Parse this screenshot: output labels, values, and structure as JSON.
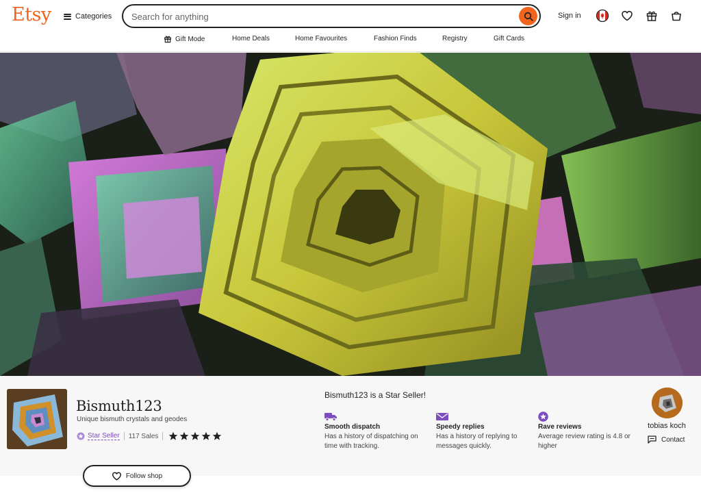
{
  "header": {
    "logo": "Etsy",
    "categories_label": "Categories",
    "search_placeholder": "Search for anything",
    "signin_label": "Sign in"
  },
  "subnav": {
    "items": [
      "Gift Mode",
      "Home Deals",
      "Home Favourites",
      "Fashion Finds",
      "Registry",
      "Gift Cards"
    ]
  },
  "shop": {
    "name": "Bismuth123",
    "tagline": "Unique bismuth crystals and geodes",
    "star_seller_label": "Star Seller",
    "sales": "117 Sales",
    "rating_stars": 5
  },
  "star_seller_panel": {
    "title": "Bismuth123 is a Star Seller!",
    "features": [
      {
        "icon": "truck-icon",
        "title": "Smooth dispatch",
        "desc": "Has a history of dispatching on time with tracking."
      },
      {
        "icon": "envelope-icon",
        "title": "Speedy replies",
        "desc": "Has a history of replying to messages quickly."
      },
      {
        "icon": "star-badge-icon",
        "title": "Rave reviews",
        "desc": "Average review rating is 4.8 or higher"
      }
    ]
  },
  "owner": {
    "name": "tobias koch",
    "contact_label": "Contact"
  },
  "follow_label": "Follow shop",
  "colors": {
    "brand": "#f1641e",
    "star_seller": "#7d4dbf"
  }
}
